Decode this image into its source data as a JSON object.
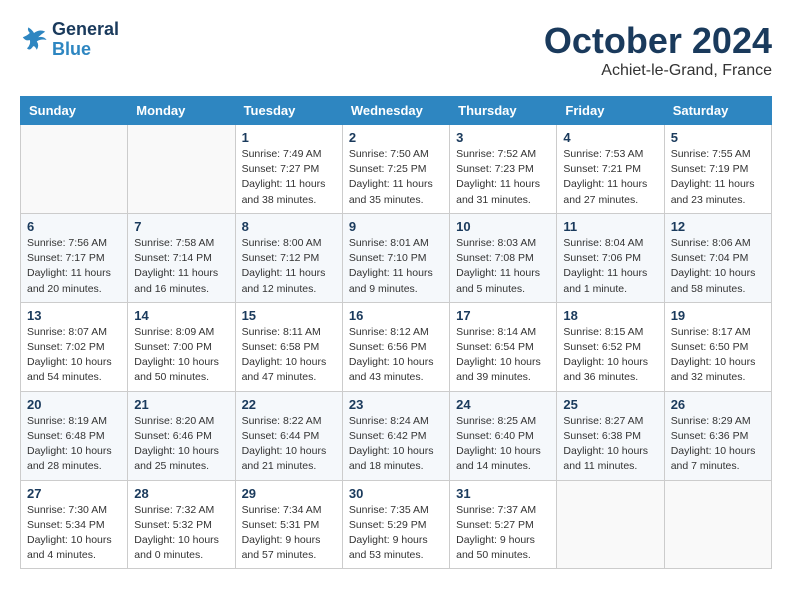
{
  "header": {
    "logo_line1": "General",
    "logo_line2": "Blue",
    "month": "October 2024",
    "location": "Achiet-le-Grand, France"
  },
  "days_of_week": [
    "Sunday",
    "Monday",
    "Tuesday",
    "Wednesday",
    "Thursday",
    "Friday",
    "Saturday"
  ],
  "weeks": [
    [
      {
        "day": "",
        "info": ""
      },
      {
        "day": "",
        "info": ""
      },
      {
        "day": "1",
        "info": "Sunrise: 7:49 AM\nSunset: 7:27 PM\nDaylight: 11 hours and 38 minutes."
      },
      {
        "day": "2",
        "info": "Sunrise: 7:50 AM\nSunset: 7:25 PM\nDaylight: 11 hours and 35 minutes."
      },
      {
        "day": "3",
        "info": "Sunrise: 7:52 AM\nSunset: 7:23 PM\nDaylight: 11 hours and 31 minutes."
      },
      {
        "day": "4",
        "info": "Sunrise: 7:53 AM\nSunset: 7:21 PM\nDaylight: 11 hours and 27 minutes."
      },
      {
        "day": "5",
        "info": "Sunrise: 7:55 AM\nSunset: 7:19 PM\nDaylight: 11 hours and 23 minutes."
      }
    ],
    [
      {
        "day": "6",
        "info": "Sunrise: 7:56 AM\nSunset: 7:17 PM\nDaylight: 11 hours and 20 minutes."
      },
      {
        "day": "7",
        "info": "Sunrise: 7:58 AM\nSunset: 7:14 PM\nDaylight: 11 hours and 16 minutes."
      },
      {
        "day": "8",
        "info": "Sunrise: 8:00 AM\nSunset: 7:12 PM\nDaylight: 11 hours and 12 minutes."
      },
      {
        "day": "9",
        "info": "Sunrise: 8:01 AM\nSunset: 7:10 PM\nDaylight: 11 hours and 9 minutes."
      },
      {
        "day": "10",
        "info": "Sunrise: 8:03 AM\nSunset: 7:08 PM\nDaylight: 11 hours and 5 minutes."
      },
      {
        "day": "11",
        "info": "Sunrise: 8:04 AM\nSunset: 7:06 PM\nDaylight: 11 hours and 1 minute."
      },
      {
        "day": "12",
        "info": "Sunrise: 8:06 AM\nSunset: 7:04 PM\nDaylight: 10 hours and 58 minutes."
      }
    ],
    [
      {
        "day": "13",
        "info": "Sunrise: 8:07 AM\nSunset: 7:02 PM\nDaylight: 10 hours and 54 minutes."
      },
      {
        "day": "14",
        "info": "Sunrise: 8:09 AM\nSunset: 7:00 PM\nDaylight: 10 hours and 50 minutes."
      },
      {
        "day": "15",
        "info": "Sunrise: 8:11 AM\nSunset: 6:58 PM\nDaylight: 10 hours and 47 minutes."
      },
      {
        "day": "16",
        "info": "Sunrise: 8:12 AM\nSunset: 6:56 PM\nDaylight: 10 hours and 43 minutes."
      },
      {
        "day": "17",
        "info": "Sunrise: 8:14 AM\nSunset: 6:54 PM\nDaylight: 10 hours and 39 minutes."
      },
      {
        "day": "18",
        "info": "Sunrise: 8:15 AM\nSunset: 6:52 PM\nDaylight: 10 hours and 36 minutes."
      },
      {
        "day": "19",
        "info": "Sunrise: 8:17 AM\nSunset: 6:50 PM\nDaylight: 10 hours and 32 minutes."
      }
    ],
    [
      {
        "day": "20",
        "info": "Sunrise: 8:19 AM\nSunset: 6:48 PM\nDaylight: 10 hours and 28 minutes."
      },
      {
        "day": "21",
        "info": "Sunrise: 8:20 AM\nSunset: 6:46 PM\nDaylight: 10 hours and 25 minutes."
      },
      {
        "day": "22",
        "info": "Sunrise: 8:22 AM\nSunset: 6:44 PM\nDaylight: 10 hours and 21 minutes."
      },
      {
        "day": "23",
        "info": "Sunrise: 8:24 AM\nSunset: 6:42 PM\nDaylight: 10 hours and 18 minutes."
      },
      {
        "day": "24",
        "info": "Sunrise: 8:25 AM\nSunset: 6:40 PM\nDaylight: 10 hours and 14 minutes."
      },
      {
        "day": "25",
        "info": "Sunrise: 8:27 AM\nSunset: 6:38 PM\nDaylight: 10 hours and 11 minutes."
      },
      {
        "day": "26",
        "info": "Sunrise: 8:29 AM\nSunset: 6:36 PM\nDaylight: 10 hours and 7 minutes."
      }
    ],
    [
      {
        "day": "27",
        "info": "Sunrise: 7:30 AM\nSunset: 5:34 PM\nDaylight: 10 hours and 4 minutes."
      },
      {
        "day": "28",
        "info": "Sunrise: 7:32 AM\nSunset: 5:32 PM\nDaylight: 10 hours and 0 minutes."
      },
      {
        "day": "29",
        "info": "Sunrise: 7:34 AM\nSunset: 5:31 PM\nDaylight: 9 hours and 57 minutes."
      },
      {
        "day": "30",
        "info": "Sunrise: 7:35 AM\nSunset: 5:29 PM\nDaylight: 9 hours and 53 minutes."
      },
      {
        "day": "31",
        "info": "Sunrise: 7:37 AM\nSunset: 5:27 PM\nDaylight: 9 hours and 50 minutes."
      },
      {
        "day": "",
        "info": ""
      },
      {
        "day": "",
        "info": ""
      }
    ]
  ]
}
